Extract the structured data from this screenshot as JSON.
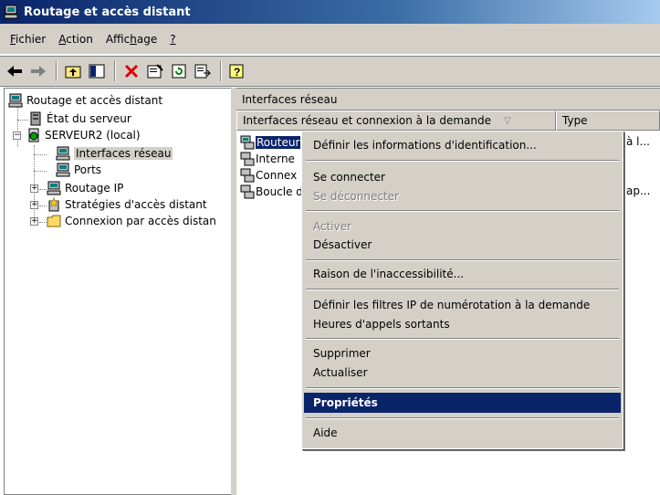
{
  "window": {
    "title": "Routage et accès distant"
  },
  "menubar": {
    "items": [
      {
        "label": "Fichier",
        "accel": "F"
      },
      {
        "label": "Action",
        "accel": "A"
      },
      {
        "label": "Affichage",
        "accel": "h"
      },
      {
        "label": "?",
        "accel": "?"
      }
    ]
  },
  "toolbar": {
    "buttons": [
      "back-icon",
      "forward-icon",
      "up-folder-icon",
      "show-hide-tree-icon",
      "delete-icon",
      "properties-icon",
      "refresh-icon",
      "export-list-icon",
      "help-icon"
    ]
  },
  "tree": {
    "root": "Routage et accès distant",
    "server_status": "État du serveur",
    "server": "SERVEUR2 (local)",
    "children": [
      "Interfaces réseau",
      "Ports",
      "Routage IP",
      "Stratégies d'accès distant",
      "Connexion par accès distan"
    ]
  },
  "right": {
    "title": "Interfaces réseau",
    "columns": [
      "Interfaces réseau et connexion à la demande",
      "Type"
    ],
    "rows": [
      {
        "name": "Routeur",
        "type": "à l..."
      },
      {
        "name": "Interne",
        "type": ""
      },
      {
        "name": "Connex",
        "type": ""
      },
      {
        "name": "Boucle d",
        "type": "ap..."
      }
    ]
  },
  "context_menu": {
    "items": [
      "Définir les informations d'identification...",
      "Se connecter",
      "Se déconnecter",
      "Activer",
      "Désactiver",
      "Raison de l'inaccessibilité...",
      "Définir les filtres IP de numérotation à la demande",
      "Heures d'appels sortants",
      "Supprimer",
      "Actualiser",
      "Propriétés",
      "Aide"
    ]
  }
}
